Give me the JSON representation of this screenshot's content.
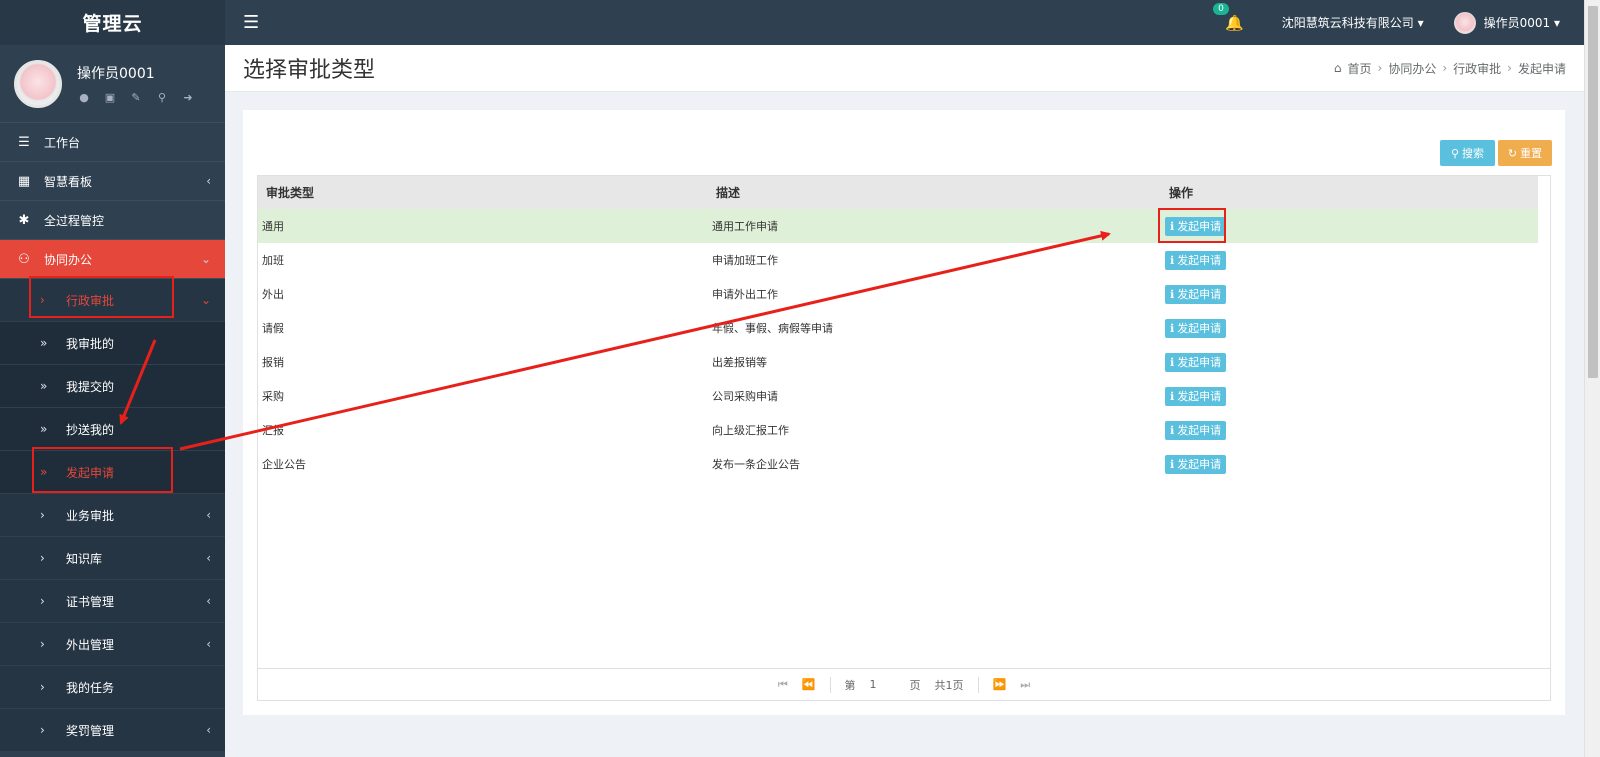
{
  "brand": "管理云",
  "sidebar": {
    "user_name": "操作员0001",
    "user_icons": [
      "user-icon",
      "photo-icon",
      "edit-icon",
      "key-icon",
      "logout-icon"
    ],
    "items": [
      {
        "label": "工作台",
        "icon": "indent-icon"
      },
      {
        "label": "智慧看板",
        "icon": "dashboard-icon"
      },
      {
        "label": "全过程管控",
        "icon": "asterisk-icon"
      },
      {
        "label": "协同办公",
        "icon": "users-icon"
      }
    ],
    "sub_items": [
      {
        "label": "行政审批"
      },
      {
        "label": "我审批的"
      },
      {
        "label": "我提交的"
      },
      {
        "label": "抄送我的"
      },
      {
        "label": "发起申请"
      },
      {
        "label": "业务审批"
      },
      {
        "label": "知识库"
      },
      {
        "label": "证书管理"
      },
      {
        "label": "外出管理"
      },
      {
        "label": "我的任务"
      },
      {
        "label": "奖罚管理"
      }
    ]
  },
  "topbar": {
    "notification_count": "0",
    "company": "沈阳慧筑云科技有限公司",
    "user": "操作员0001"
  },
  "page": {
    "title": "选择审批类型",
    "breadcrumb": [
      "首页",
      "协同办公",
      "行政审批",
      "发起申请"
    ]
  },
  "toolbar": {
    "search_label": "搜索",
    "reset_label": "重置"
  },
  "table": {
    "headers": [
      "审批类型",
      "描述",
      "操作"
    ],
    "action_label": "发起申请",
    "rows": [
      {
        "type": "通用",
        "desc": "通用工作申请"
      },
      {
        "type": "加班",
        "desc": "申请加班工作"
      },
      {
        "type": "外出",
        "desc": "申请外出工作"
      },
      {
        "type": "请假",
        "desc": "年假、事假、病假等申请"
      },
      {
        "type": "报销",
        "desc": "出差报销等"
      },
      {
        "type": "采购",
        "desc": "公司采购申请"
      },
      {
        "type": "汇报",
        "desc": "向上级汇报工作"
      },
      {
        "type": "企业公告",
        "desc": "发布一条企业公告"
      }
    ]
  },
  "pager": {
    "page_prefix": "第",
    "page_value": "1",
    "page_suffix": "页",
    "total": "共1页"
  },
  "colors": {
    "sidebar_bg": "#2f4050",
    "active_red": "#e5473b",
    "info_blue": "#5bc0de",
    "warning_orange": "#f0ad4e",
    "highlight_green": "#dff0d8",
    "annotation_red": "#e8201a"
  }
}
